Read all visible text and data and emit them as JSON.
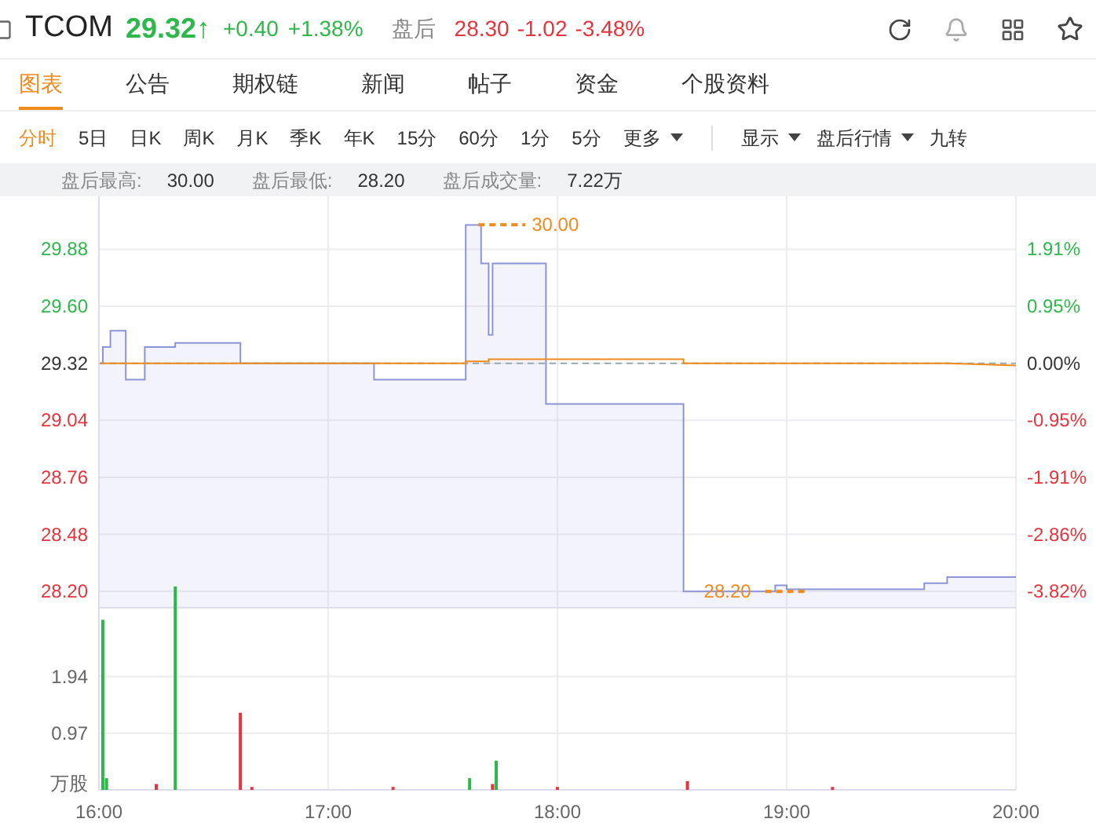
{
  "header": {
    "symbol": "TCOM",
    "quote": {
      "color": "#2eb84b",
      "price": "29.32",
      "arrow": "↑",
      "change": "+0.40",
      "change_pct": "+1.38%"
    },
    "after_label": "盘后",
    "after_quote": {
      "color": "#e5343d",
      "price": "28.30",
      "change": "-1.02",
      "change_pct": "-3.48%"
    }
  },
  "tabs": [
    {
      "label": "图表",
      "selected": true
    },
    {
      "label": "公告",
      "selected": false
    },
    {
      "label": "期权链",
      "selected": false
    },
    {
      "label": "新闻",
      "selected": false
    },
    {
      "label": "帖子",
      "selected": false
    },
    {
      "label": "资金",
      "selected": false
    },
    {
      "label": "个股资料",
      "selected": false
    }
  ],
  "periods": [
    {
      "label": "分时",
      "selected": true
    },
    {
      "label": "5日",
      "selected": false
    },
    {
      "label": "日K",
      "selected": false
    },
    {
      "label": "周K",
      "selected": false
    },
    {
      "label": "月K",
      "selected": false
    },
    {
      "label": "季K",
      "selected": false
    },
    {
      "label": "年K",
      "selected": false
    },
    {
      "label": "15分",
      "selected": false
    },
    {
      "label": "60分",
      "selected": false
    },
    {
      "label": "1分",
      "selected": false
    },
    {
      "label": "5分",
      "selected": false
    },
    {
      "label": "更多",
      "selected": false,
      "kind": "dropdown"
    }
  ],
  "options": [
    {
      "label": "显示",
      "kind": "dropdown"
    },
    {
      "label": "盘后行情",
      "kind": "dropdown"
    },
    {
      "label": "九转",
      "kind": "plain"
    }
  ],
  "stats": [
    {
      "label": "盘后最高:",
      "value": "30.00"
    },
    {
      "label": "盘后最低:",
      "value": "28.20"
    },
    {
      "label": "盘后成交量:",
      "value": "7.22万"
    }
  ],
  "price_chart": {
    "chart_data": {
      "type": "area",
      "x": [
        16.0,
        16.017,
        16.017,
        16.05,
        16.05,
        16.117,
        16.117,
        16.2,
        16.2,
        16.333,
        16.333,
        16.617,
        16.617,
        17.2,
        17.2,
        17.6,
        17.6,
        17.667,
        17.667,
        17.7,
        17.7,
        17.717,
        17.717,
        17.95,
        17.95,
        18.55,
        18.55,
        18.95,
        18.95,
        19.0,
        19.0,
        19.6,
        19.6,
        19.7,
        19.7,
        20.0
      ],
      "series": [
        {
          "color": "#8c94d6",
          "values": [
            29.32,
            29.32,
            29.4,
            29.4,
            29.48,
            29.48,
            29.24,
            29.24,
            29.4,
            29.4,
            29.42,
            29.42,
            29.32,
            29.32,
            29.24,
            29.24,
            30.0,
            30.0,
            29.81,
            29.81,
            29.46,
            29.46,
            29.81,
            29.81,
            29.12,
            29.12,
            28.2,
            28.2,
            28.23,
            28.23,
            28.21,
            28.21,
            28.24,
            28.24,
            28.27,
            28.27
          ]
        },
        {
          "type": "line",
          "color": "#f08a1c",
          "values": [
            29.32,
            29.32,
            29.32,
            29.32,
            29.32,
            29.32,
            29.32,
            29.32,
            29.32,
            29.32,
            29.32,
            29.32,
            29.32,
            29.32,
            29.32,
            29.32,
            29.33,
            29.33,
            29.33,
            29.33,
            29.34,
            29.34,
            29.34,
            29.34,
            29.34,
            29.34,
            29.32,
            29.32,
            29.32,
            29.32,
            29.32,
            29.32,
            29.32,
            29.32,
            29.32,
            29.31
          ]
        }
      ],
      "xlim": [
        16,
        20
      ],
      "ylim": [
        28.12,
        30.14
      ],
      "grid": true,
      "yticks": [
        {
          "value": 29.88,
          "label": "29.88"
        },
        {
          "value": 29.6,
          "label": "29.60"
        },
        {
          "value": 29.32,
          "label": "29.32"
        },
        {
          "value": 29.04,
          "label": "29.04"
        },
        {
          "value": 28.76,
          "label": "28.76"
        },
        {
          "value": 28.48,
          "label": "28.48"
        },
        {
          "value": 28.2,
          "label": "28.20"
        }
      ],
      "ref_lines": [
        {
          "axis": "y",
          "value": 29.32,
          "color": "#99aaaa"
        }
      ],
      "annotations": [
        "30.00",
        "28.20"
      ]
    },
    "percent_axis": [
      {
        "label": "1.91%",
        "kind": "up"
      },
      {
        "label": "0.95%",
        "kind": "up"
      },
      {
        "label": "0.00%",
        "kind": "flat"
      },
      {
        "label": "-0.95%",
        "kind": "down"
      },
      {
        "label": "-1.91%",
        "kind": "down"
      },
      {
        "label": "-2.86%",
        "kind": "down"
      },
      {
        "label": "-3.82%",
        "kind": "down"
      }
    ]
  },
  "volume_chart": {
    "unit": "万股",
    "chart_data": {
      "type": "bar",
      "x": [
        16.017,
        16.033,
        16.25,
        16.333,
        16.617,
        16.667,
        17.283,
        17.617,
        17.717,
        17.733,
        18.0,
        18.567,
        19.2
      ],
      "series": [
        {
          "color": "#2eb84b",
          "values": [
            2.91,
            0.2,
            null,
            3.48,
            null,
            null,
            null,
            0.2,
            null,
            0.5,
            null,
            null,
            null
          ]
        },
        {
          "color": "#e5343d",
          "values": [
            null,
            null,
            0.1,
            null,
            1.32,
            0.05,
            0.05,
            null,
            0.1,
            null,
            0.05,
            0.15,
            0.05
          ]
        }
      ],
      "xlim": [
        16,
        20
      ],
      "ylim": [
        0,
        3.6
      ],
      "grid": true,
      "yticks": [
        {
          "value": 1.94,
          "label": "1.94"
        },
        {
          "value": 0.97,
          "label": "0.97"
        }
      ],
      "xticks": [
        {
          "value": 16,
          "label": "16:00"
        },
        {
          "value": 17,
          "label": "17:00"
        },
        {
          "value": 18,
          "label": "18:00"
        },
        {
          "value": 19,
          "label": "19:00"
        },
        {
          "value": 20,
          "label": "20:00"
        }
      ]
    }
  }
}
